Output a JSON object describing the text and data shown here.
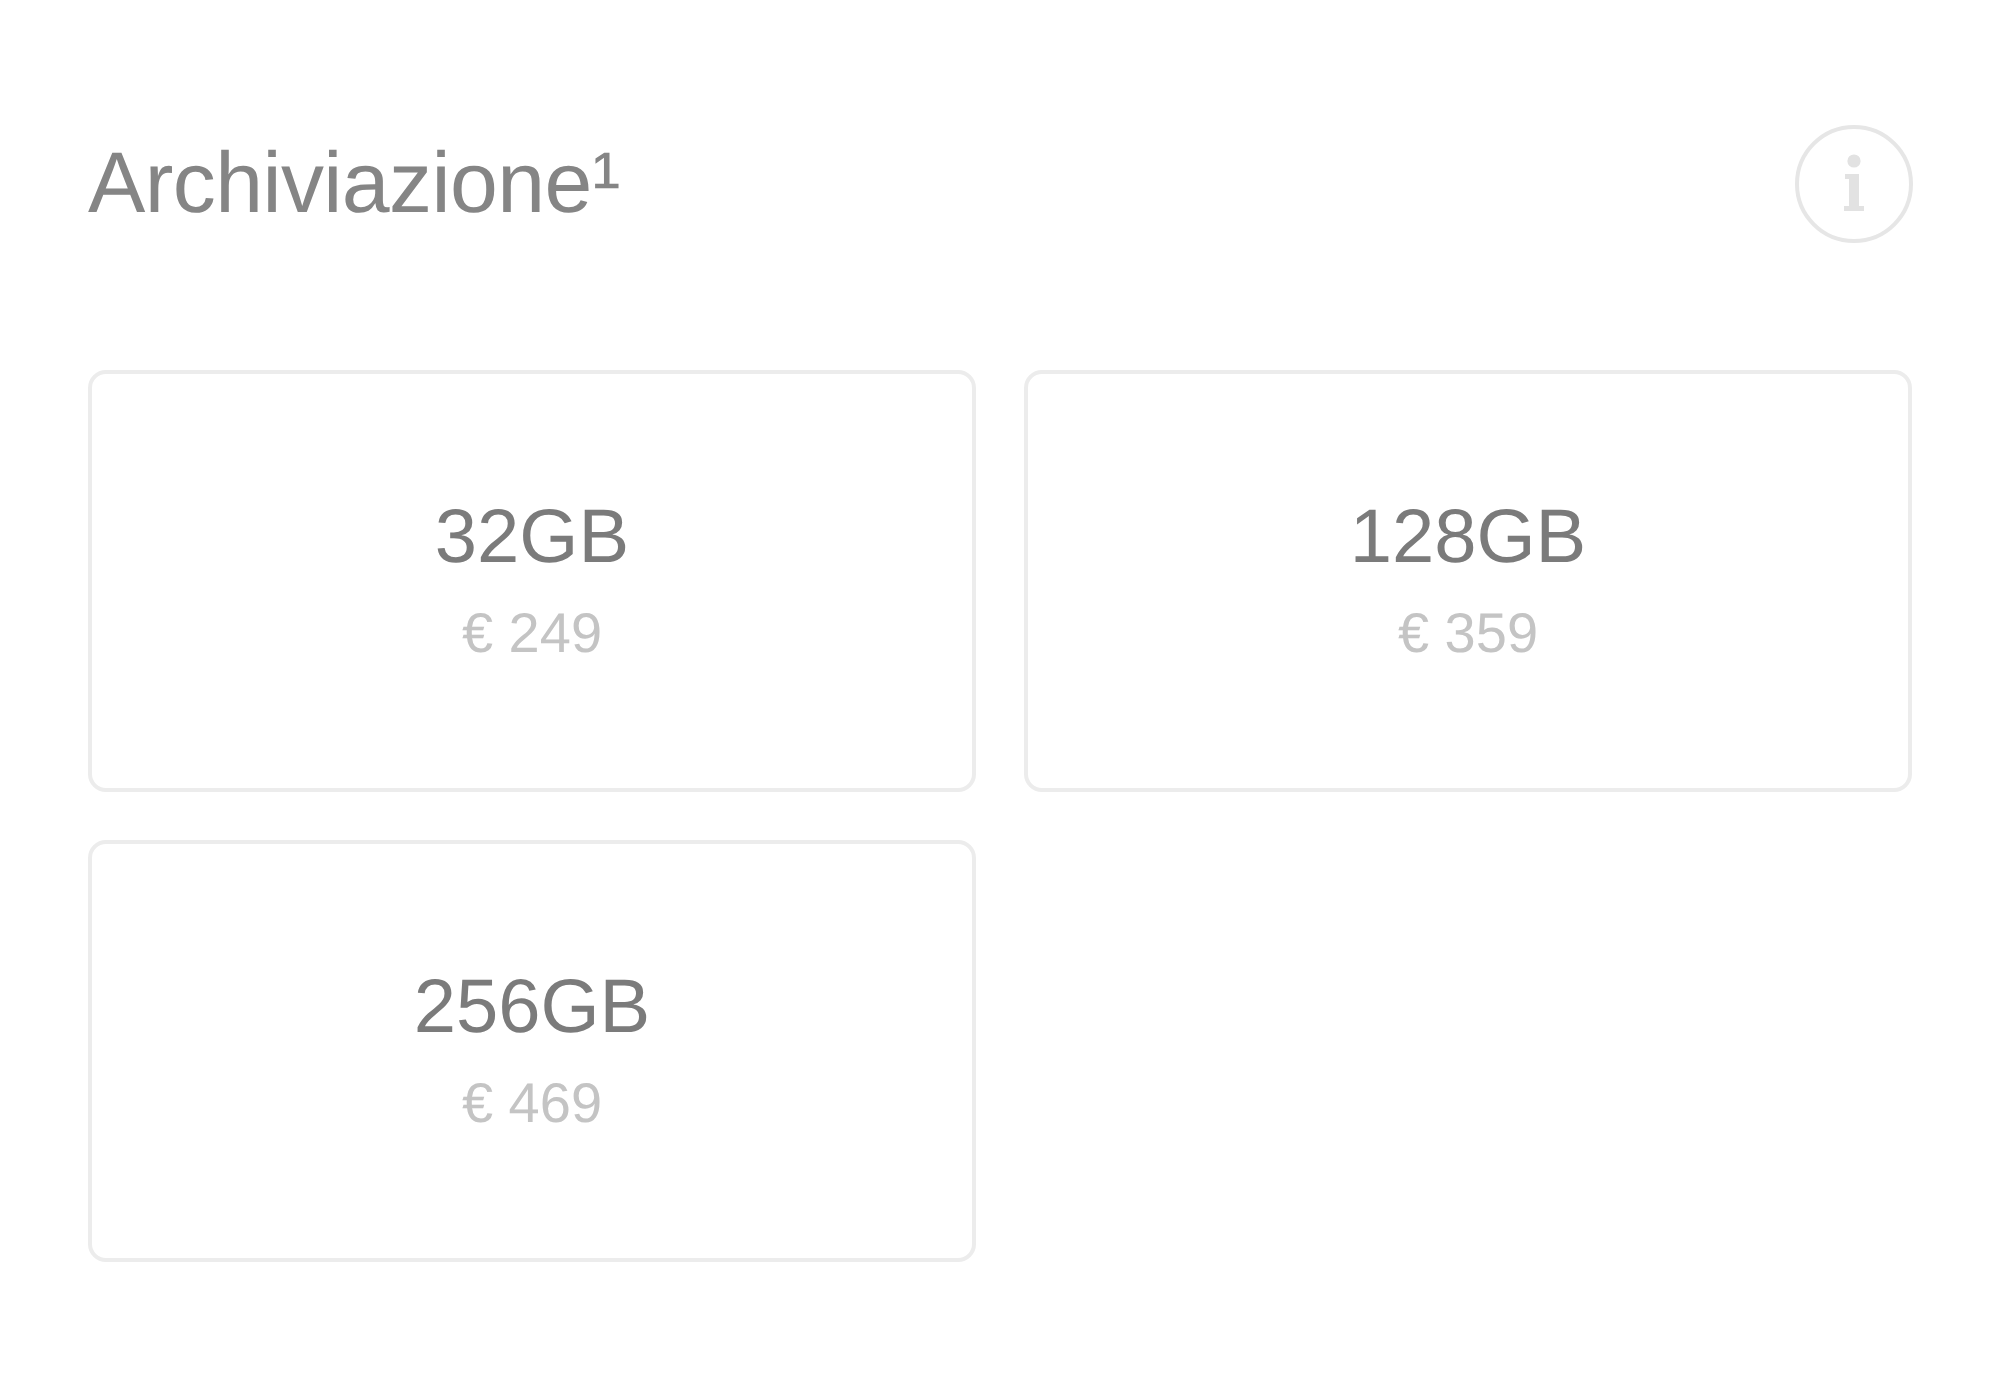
{
  "section": {
    "title": "Archiviazione¹"
  },
  "options": [
    {
      "capacity": "32GB",
      "price": "€ 249"
    },
    {
      "capacity": "128GB",
      "price": "€ 359"
    },
    {
      "capacity": "256GB",
      "price": "€ 469"
    }
  ]
}
